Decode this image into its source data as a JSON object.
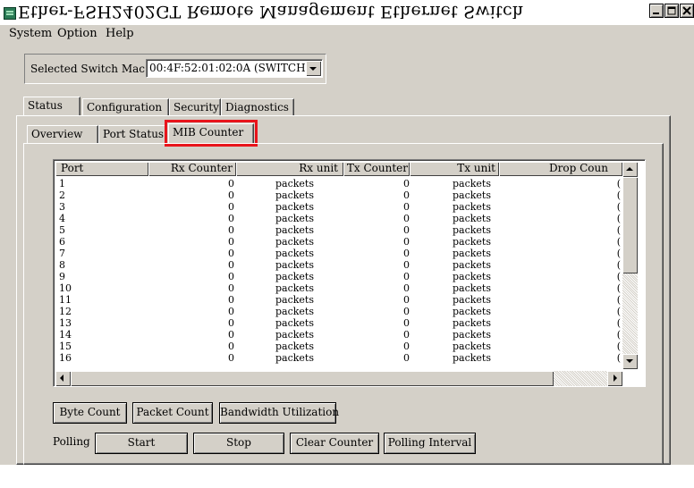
{
  "window": {
    "title": "Ether-FSH2402GT Remote Management Ethernet Switch"
  },
  "menu": [
    "System",
    "Option",
    "Help"
  ],
  "mac_selector": {
    "label": "Selected Switch Mac:",
    "value": "00:4F:52:01:02:0A (SWITCH"
  },
  "main_tabs": [
    "Status",
    "Configuration",
    "Security",
    "Diagnostics"
  ],
  "sub_tabs": [
    "Overview",
    "Port Status",
    "MIB Counter"
  ],
  "table": {
    "columns": [
      "Port",
      "Rx Counter",
      "Rx unit",
      "Tx Counter",
      "Tx unit",
      "Drop Coun"
    ],
    "rows": [
      [
        "1",
        "0",
        "packets",
        "0",
        "packets",
        "("
      ],
      [
        "2",
        "0",
        "packets",
        "0",
        "packets",
        "("
      ],
      [
        "3",
        "0",
        "packets",
        "0",
        "packets",
        "("
      ],
      [
        "4",
        "0",
        "packets",
        "0",
        "packets",
        "("
      ],
      [
        "5",
        "0",
        "packets",
        "0",
        "packets",
        "("
      ],
      [
        "6",
        "0",
        "packets",
        "0",
        "packets",
        "("
      ],
      [
        "7",
        "0",
        "packets",
        "0",
        "packets",
        "("
      ],
      [
        "8",
        "0",
        "packets",
        "0",
        "packets",
        "("
      ],
      [
        "9",
        "0",
        "packets",
        "0",
        "packets",
        "("
      ],
      [
        "10",
        "0",
        "packets",
        "0",
        "packets",
        "("
      ],
      [
        "11",
        "0",
        "packets",
        "0",
        "packets",
        "("
      ],
      [
        "12",
        "0",
        "packets",
        "0",
        "packets",
        "("
      ],
      [
        "13",
        "0",
        "packets",
        "0",
        "packets",
        "("
      ],
      [
        "14",
        "0",
        "packets",
        "0",
        "packets",
        "("
      ],
      [
        "15",
        "0",
        "packets",
        "0",
        "packets",
        "("
      ],
      [
        "16",
        "0",
        "packets",
        "0",
        "packets",
        "("
      ]
    ]
  },
  "count_buttons": [
    "Byte Count",
    "Packet Count",
    "Bandwidth Utilization"
  ],
  "polling": {
    "label": "Polling",
    "buttons": [
      "Start",
      "Stop",
      "Clear Counter",
      "Polling Interval"
    ]
  },
  "colors": {
    "window_bg": "#d4d0c8",
    "highlight": "#e8141b"
  }
}
